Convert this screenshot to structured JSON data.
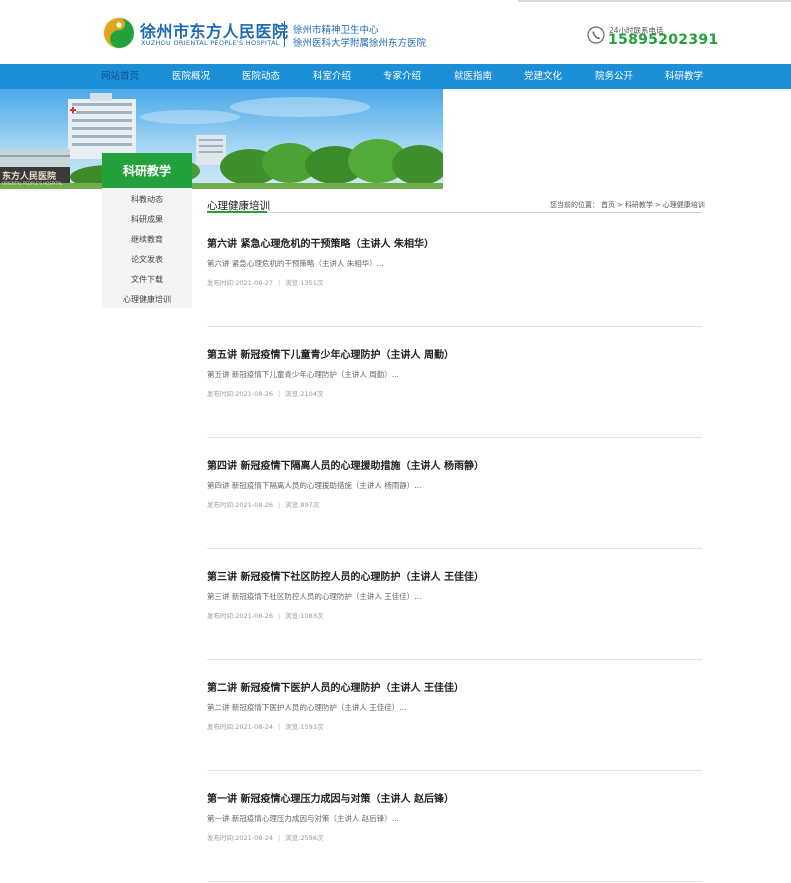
{
  "header": {
    "name_cn": "徐州市东方人民医院",
    "name_en": "XUZHOU ORIENTAL PEOPLE'S HOSPITAL",
    "sub1": "徐州市精神卫生中心",
    "sub2": "徐州医科大学附属徐州东方医院",
    "hotline_label": "24小时联系电话",
    "hotline_number": "15895202391",
    "brand_color": "#1f6bb0",
    "accent_color": "#22a13c"
  },
  "banner": {
    "sign_text": "东方人民医院",
    "sign_sub": "ORIENTAL PEOPLE'S HOSPITAL"
  },
  "nav": {
    "items": [
      {
        "label": "网站首页"
      },
      {
        "label": "医院概况"
      },
      {
        "label": "医院动态"
      },
      {
        "label": "科室介绍"
      },
      {
        "label": "专家介绍"
      },
      {
        "label": "就医指南"
      },
      {
        "label": "党建文化"
      },
      {
        "label": "院务公开"
      },
      {
        "label": "科研教学"
      }
    ],
    "bg_color": "#1c8fd6"
  },
  "sidebar": {
    "title": "科研教学",
    "items": [
      {
        "label": "科教动态"
      },
      {
        "label": "科研成果"
      },
      {
        "label": "继续教育"
      },
      {
        "label": "论文发表"
      },
      {
        "label": "文件下载"
      },
      {
        "label": "心理健康培训"
      }
    ]
  },
  "section": {
    "title": "心理健康培训",
    "breadcrumb": {
      "prefix": "您当前的位置：",
      "items": [
        "首页",
        "科研教学",
        "心理健康培训"
      ],
      "sep": ">"
    }
  },
  "articles": [
    {
      "title": "第六讲 紧急心理危机的干预策略（主讲人 朱相华）",
      "summary": "第六讲 紧急心理危机的干预策略（主讲人 朱相华）...",
      "date": "发布时间:2021-08-27",
      "views": "浏览:1351次"
    },
    {
      "title": "第五讲 新冠疫情下儿童青少年心理防护（主讲人 周勤）",
      "summary": "第五讲 新冠疫情下儿童青少年心理防护（主讲人 周勤）...",
      "date": "发布时间:2021-08-26",
      "views": "浏览:2104次"
    },
    {
      "title": "第四讲 新冠疫情下隔离人员的心理援助措施（主讲人 杨雨静）",
      "summary": "第四讲 新冠疫情下隔离人员的心理援助措施（主讲人 杨雨静）...",
      "date": "发布时间:2021-08-26",
      "views": "浏览:897次"
    },
    {
      "title": "第三讲 新冠疫情下社区防控人员的心理防护（主讲人 王佳佳）",
      "summary": "第三讲 新冠疫情下社区防控人员的心理防护（主讲人 王佳佳）...",
      "date": "发布时间:2021-08-26",
      "views": "浏览:1083次"
    },
    {
      "title": "第二讲 新冠疫情下医护人员的心理防护（主讲人 王佳佳）",
      "summary": "第二讲 新冠疫情下医护人员的心理防护（主讲人 王佳佳）...",
      "date": "发布时间:2021-08-24",
      "views": "浏览:1593次"
    },
    {
      "title": "第一讲 新冠疫情心理压力成因与对策（主讲人 赵后锋）",
      "summary": "第一讲 新冠疫情心理压力成因与对策（主讲人 赵后锋）...",
      "date": "发布时间:2021-08-24",
      "views": "浏览:2598次"
    }
  ]
}
